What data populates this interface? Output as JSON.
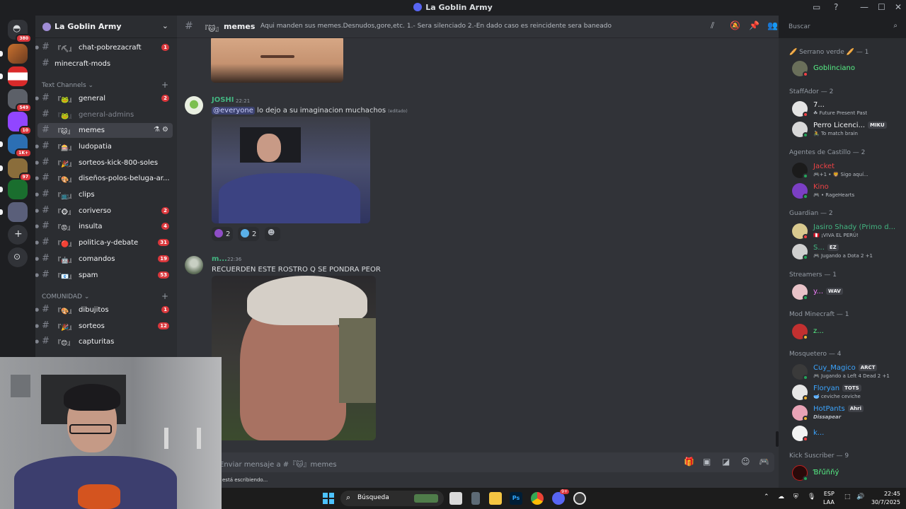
{
  "window": {
    "title": "La Goblin Army",
    "controls": [
      "▭",
      "?",
      "—",
      "☐",
      "✕"
    ]
  },
  "server_rail": {
    "items": [
      {
        "name": "discord-home",
        "badge": "380"
      },
      {
        "name": "server-1",
        "badge": ""
      },
      {
        "name": "server-psbiist",
        "badge": ""
      },
      {
        "name": "server-3",
        "badge": "549"
      },
      {
        "name": "server-twitch",
        "badge": "10"
      },
      {
        "name": "server-5",
        "badge": "1K+"
      },
      {
        "name": "server-6",
        "badge": "97"
      },
      {
        "name": "server-7",
        "badge": ""
      },
      {
        "name": "server-8",
        "badge": ""
      }
    ],
    "add_label": "+",
    "explore_label": "⊙"
  },
  "guild": {
    "name": "La Goblin Army",
    "chevron": "⌄"
  },
  "channels": {
    "top": [
      {
        "name": "chat-pobrezacraft",
        "prefix": "『⛏』",
        "count": "1"
      },
      {
        "name": "minecraft-mods",
        "prefix": "",
        "count": ""
      }
    ],
    "category_text": "Text Channels ⌄",
    "text": [
      {
        "name": "general",
        "prefix": "『🐸』",
        "count": "2"
      },
      {
        "name": "general-admins",
        "prefix": "『🐸』",
        "count": ""
      },
      {
        "name": "memes",
        "prefix": "『🐱』",
        "count": ""
      },
      {
        "name": "ludopatia",
        "prefix": "『🎰』",
        "count": ""
      },
      {
        "name": "sorteos-kick-800-soles",
        "prefix": "『🎉』",
        "count": ""
      },
      {
        "name": "diseños-polos-beluga-ar...",
        "prefix": "『🎨』",
        "count": ""
      },
      {
        "name": "clips",
        "prefix": "『📺』",
        "count": ""
      },
      {
        "name": "coriverso",
        "prefix": "『🐵』",
        "count": "2"
      },
      {
        "name": "insulta",
        "prefix": "『😡』",
        "count": "4"
      },
      {
        "name": "politica-y-debate",
        "prefix": "『🔴』",
        "count": "31"
      },
      {
        "name": "comandos",
        "prefix": "『🤖』",
        "count": "19"
      },
      {
        "name": "spam",
        "prefix": "『📧』",
        "count": "53"
      }
    ],
    "category_comunidad": "COMUNIDAD ⌄",
    "comunidad": [
      {
        "name": "dibujitos",
        "prefix": "『🎨』",
        "count": "1"
      },
      {
        "name": "sorteos",
        "prefix": "『🎉』",
        "count": "12"
      },
      {
        "name": "capturitas",
        "prefix": "『😊』",
        "count": ""
      }
    ],
    "active_icons": "⚗ ⚙"
  },
  "chat_header": {
    "channel": "memes",
    "prefix": "『🐱』",
    "topic": "Aqui manden sus memes.Desnudos,gore,etc. 1.- Sera silenciado 2.-En dado caso es reincidente sera baneado",
    "search_placeholder": "Buscar"
  },
  "messages": [
    {
      "author": "JOSHI",
      "author_color": "#43b581",
      "time": "22:21",
      "mention": "@everyone",
      "text": "lo dejo a su imaginacion muchachos",
      "edited": "(editado)",
      "reactions": [
        {
          "emoji": "eggplant",
          "count": "2"
        },
        {
          "emoji": "sweat-drops",
          "count": "2"
        }
      ]
    },
    {
      "author": "m...",
      "author_color": "#43b581",
      "time": "22:36",
      "text": "RECUERDEN ESTE ROSTRO Q SE PONDRA PEOR"
    }
  ],
  "composer": {
    "placeholder": "Enviar mensaje a #『🐱』memes",
    "typing": "está escribiendo..."
  },
  "members": {
    "groups": [
      {
        "role": "🥖 Serrano verde 🥖 — 1",
        "members": [
          {
            "name": "Goblinciano",
            "color": "#57f287",
            "tag": "",
            "activity": ""
          }
        ]
      },
      {
        "role": "StaffAdor — 2",
        "members": [
          {
            "name": "7...",
            "color": "#f2f3f5",
            "tag": "",
            "activity": "☘ Future Present Past"
          },
          {
            "name": "Perro Licenci...",
            "color": "#f2f3f5",
            "tag": "MIKU",
            "activity": "🚴 To match brain"
          }
        ]
      },
      {
        "role": "Agentes de Castillo — 2",
        "members": [
          {
            "name": "Jacket",
            "color": "#ed4245",
            "tag": "",
            "activity": "🎮+1 • 🦁 Sigo aquí..."
          },
          {
            "name": "Kino",
            "color": "#ed4245",
            "tag": "",
            "activity": "🎮 • RageHearts"
          }
        ]
      },
      {
        "role": "Guardian — 2",
        "members": [
          {
            "name": "Jasiro Shady (Primo d...",
            "color": "#43b581",
            "tag": "",
            "activity": "🇵🇪 ¡VIVA EL PERÚ!"
          },
          {
            "name": "S...",
            "color": "#43b581",
            "tag": "EZ",
            "activity": "🎮 Jugando a Dota 2 +1"
          }
        ]
      },
      {
        "role": "Streamers — 1",
        "members": [
          {
            "name": "y...",
            "color": "#f47fff",
            "tag": "WAV",
            "activity": ""
          }
        ]
      },
      {
        "role": "Mod Minecraft — 1",
        "members": [
          {
            "name": "z...",
            "color": "#57f287",
            "tag": "",
            "activity": ""
          }
        ]
      },
      {
        "role": "Mosquetero — 4",
        "members": [
          {
            "name": "Cuy_Magico",
            "color": "#3ba5ff",
            "tag": "ARCT",
            "activity": "🎮 Jugando a Left 4 Dead 2 +1"
          },
          {
            "name": "Floryan",
            "color": "#3ba5ff",
            "tag": "TOTS",
            "activity": "🥣 ceviche ceviche"
          },
          {
            "name": "HotPants",
            "color": "#3ba5ff",
            "tag": "Ahri",
            "activity": "Dissapear"
          },
          {
            "name": "k...",
            "color": "#3ba5ff",
            "tag": "",
            "activity": ""
          }
        ]
      },
      {
        "role": "Kick Suscriber — 9",
        "members": [
          {
            "name": "Ɓřűñňý",
            "color": "#57f287",
            "tag": "",
            "activity": ""
          }
        ]
      }
    ]
  },
  "taskbar": {
    "search": "Búsqueda",
    "lang_top": "ESP",
    "lang_bottom": "LAA",
    "time": "22:45",
    "date": "30/7/2025",
    "discord_badge": "9+"
  }
}
